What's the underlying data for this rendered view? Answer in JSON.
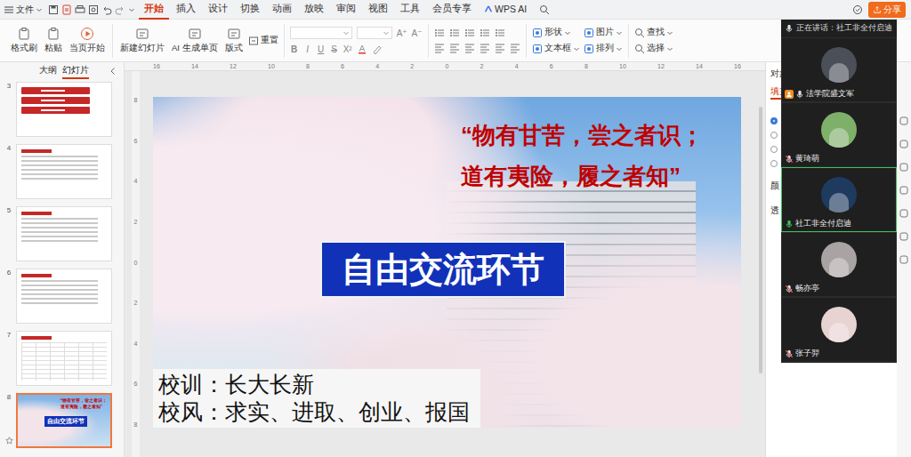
{
  "menu": {
    "file": "文件"
  },
  "tabs": [
    {
      "label": "开始",
      "selected": true,
      "kind": "text"
    },
    {
      "label": "插入",
      "selected": false,
      "kind": "text"
    },
    {
      "label": "设计",
      "selected": false,
      "kind": "text"
    },
    {
      "label": "切换",
      "selected": false,
      "kind": "text"
    },
    {
      "label": "动画",
      "selected": false,
      "kind": "text"
    },
    {
      "label": "放映",
      "selected": false,
      "kind": "text"
    },
    {
      "label": "审阅",
      "selected": false,
      "kind": "text"
    },
    {
      "label": "视图",
      "selected": false,
      "kind": "text"
    },
    {
      "label": "工具",
      "selected": false,
      "kind": "text"
    },
    {
      "label": "会员专享",
      "selected": false,
      "kind": "text"
    },
    {
      "label": "WPS AI",
      "selected": false,
      "kind": "ai"
    }
  ],
  "share_button": "分享",
  "ribbon": {
    "clipboard": [
      "格式刷",
      "粘贴"
    ],
    "play": "当页开始",
    "slide_buttons": [
      "新建幻灯片",
      "AI 生成单页",
      "版式"
    ],
    "reset": "重置",
    "font_size_buttons": [
      "A⁺",
      "A⁻"
    ],
    "format_buttons": [
      "B",
      "I",
      "U",
      "S",
      "X²"
    ],
    "insert": [
      [
        "形状",
        "文本框"
      ],
      [
        "图片",
        "排列"
      ]
    ],
    "edit": [
      "查找",
      "选择"
    ]
  },
  "sidebar": {
    "tabs": [
      {
        "label": "大纲",
        "selected": false
      },
      {
        "label": "幻灯片",
        "selected": true
      }
    ],
    "slides": [
      {
        "number": "3",
        "kind": "list",
        "selected": false
      },
      {
        "number": "4",
        "kind": "text",
        "selected": false
      },
      {
        "number": "5",
        "kind": "text",
        "selected": false
      },
      {
        "number": "6",
        "kind": "text",
        "selected": false
      },
      {
        "number": "7",
        "kind": "table",
        "selected": false
      },
      {
        "number": "8",
        "kind": "cover",
        "selected": true
      }
    ]
  },
  "rulers": {
    "horizontal": [
      "16",
      "14",
      "12",
      "10",
      "8",
      "6",
      "4",
      "2",
      "0",
      "2",
      "4",
      "6",
      "8",
      "10",
      "12",
      "14",
      "16"
    ],
    "vertical": [
      "8",
      "6",
      "4",
      "2",
      "0",
      "2",
      "4",
      "6",
      "8"
    ]
  },
  "slide": {
    "quote": [
      "“物有甘苦，尝之者识；",
      "道有夷险，履之者知”"
    ],
    "title": "自由交流环节",
    "motto": [
      "校训：长大长新",
      "校风：求实、进取、创业、报国"
    ]
  },
  "properties_panel": {
    "title": "对象",
    "tab": "填充",
    "options": [
      {
        "selected": true
      },
      {
        "selected": false
      },
      {
        "selected": false
      },
      {
        "selected": false
      }
    ],
    "labels": [
      "颜",
      "透"
    ]
  },
  "meeting": {
    "speaking_label": "正在讲话：社工非全付启迪",
    "participants": [
      {
        "name": "法学院盛文军",
        "host": true,
        "muted": false,
        "speaking": false,
        "color": "#4b4f58"
      },
      {
        "name": "黄琦萌",
        "host": false,
        "muted": true,
        "speaking": false,
        "color": "#7fb06a"
      },
      {
        "name": "社工非全付启迪",
        "host": false,
        "muted": false,
        "speaking": true,
        "color": "#1e3a5f"
      },
      {
        "name": "畅亦亭",
        "host": false,
        "muted": true,
        "speaking": false,
        "color": "#a9a3a3"
      },
      {
        "name": "张子羿",
        "host": false,
        "muted": true,
        "speaking": false,
        "color": "#e8d3d3"
      }
    ]
  }
}
